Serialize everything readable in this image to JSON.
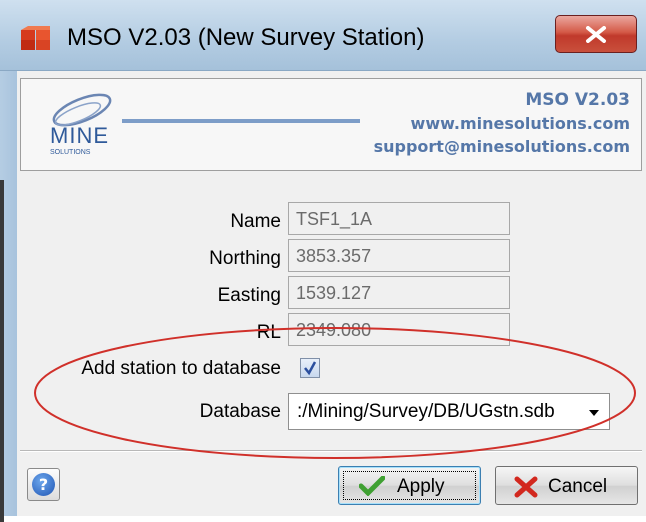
{
  "window": {
    "title": "MSO V2.03  (New Survey Station)",
    "close_label": "x"
  },
  "header": {
    "product": "MSO V2.03",
    "website": "www.minesolutions.com",
    "email": "support@minesolutions.com",
    "logo_text": "MINE",
    "logo_subtext": "SOLUTIONS"
  },
  "form": {
    "name_label": "Name",
    "name_value": "TSF1_1A",
    "northing_label": "Northing",
    "northing_value": "3853.357",
    "easting_label": "Easting",
    "easting_value": "1539.127",
    "rl_label": "RL",
    "rl_value": "2349.080",
    "add_station_label": "Add station to database",
    "add_station_checked": true,
    "database_label": "Database",
    "database_value": ":/Mining/Survey/DB/UGstn.sdb"
  },
  "buttons": {
    "help": "?",
    "apply": "Apply",
    "cancel": "Cancel"
  },
  "colors": {
    "accent": "#5577a8",
    "annotation": "#d0302a"
  }
}
